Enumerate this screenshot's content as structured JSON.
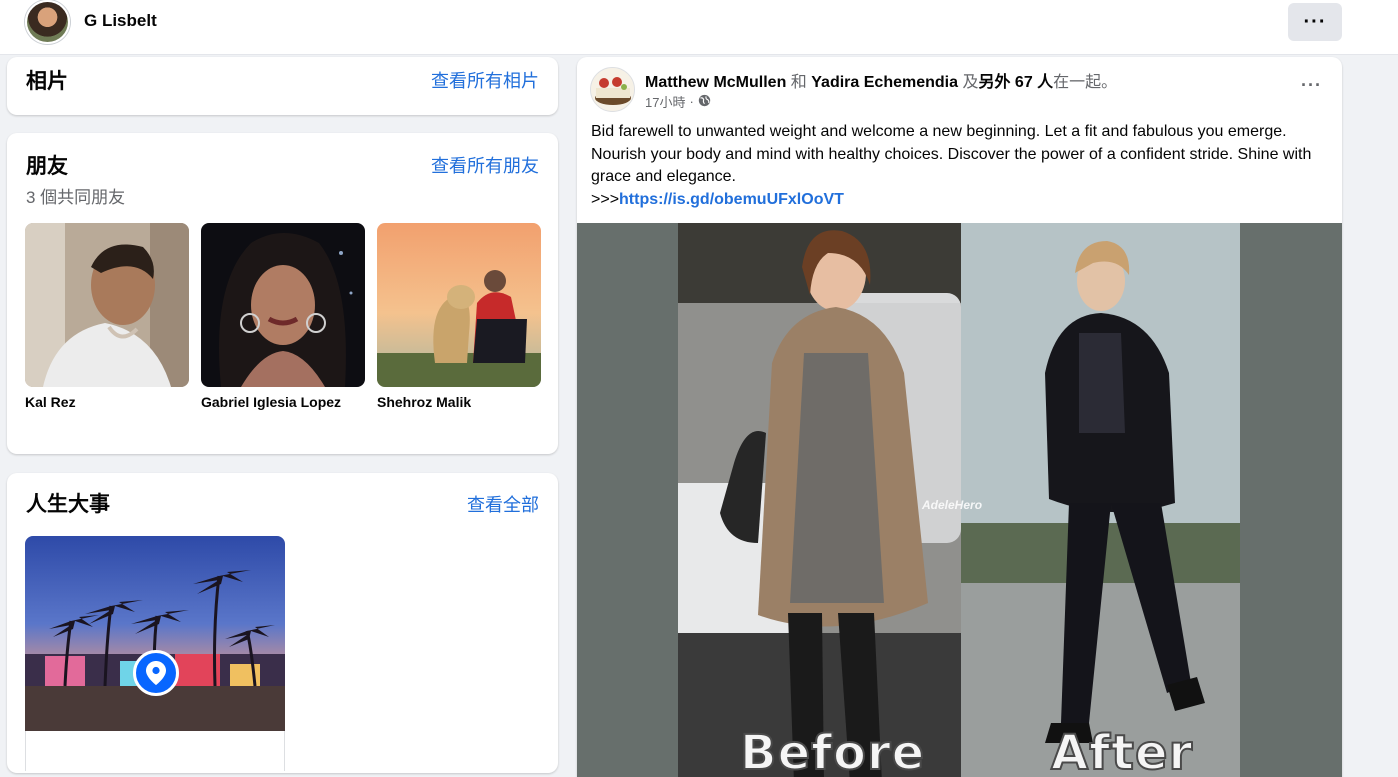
{
  "topbar": {
    "profile_name": "G Lisbelt",
    "more_label": "···"
  },
  "photos": {
    "title": "相片",
    "see_all": "查看所有相片"
  },
  "friends": {
    "title": "朋友",
    "see_all": "查看所有朋友",
    "mutual": "3 個共同朋友",
    "items": [
      {
        "name": "Kal Rez"
      },
      {
        "name": "Gabriel Iglesia Lopez"
      },
      {
        "name": "Shehroz Malik"
      }
    ]
  },
  "life_events": {
    "title": "人生大事",
    "see_all": "查看全部"
  },
  "post": {
    "author": "Matthew McMullen",
    "conj": "和",
    "tagged": "Yadira Echemendia",
    "and_others": "及",
    "others": "另外 67 人",
    "suffix": "在一起。",
    "time": "17小時",
    "dot": "·",
    "more_label": "···",
    "text": "Bid farewell to unwanted weight and welcome a new beginning. Let a fit and fabulous you emerge. Nourish your body and mind with healthy choices. Discover the power of a confident stride. Shine with grace and elegance.",
    "link_prefix": ">>>",
    "link": "https://is.gd/obemuUFxlOoVT",
    "image_labels": {
      "before": "Before",
      "after": "After",
      "watermark": "AdeleHero"
    }
  },
  "colors": {
    "link": "#216fdb",
    "page_bg": "#f0f2f5",
    "pin": "#0866ff"
  }
}
